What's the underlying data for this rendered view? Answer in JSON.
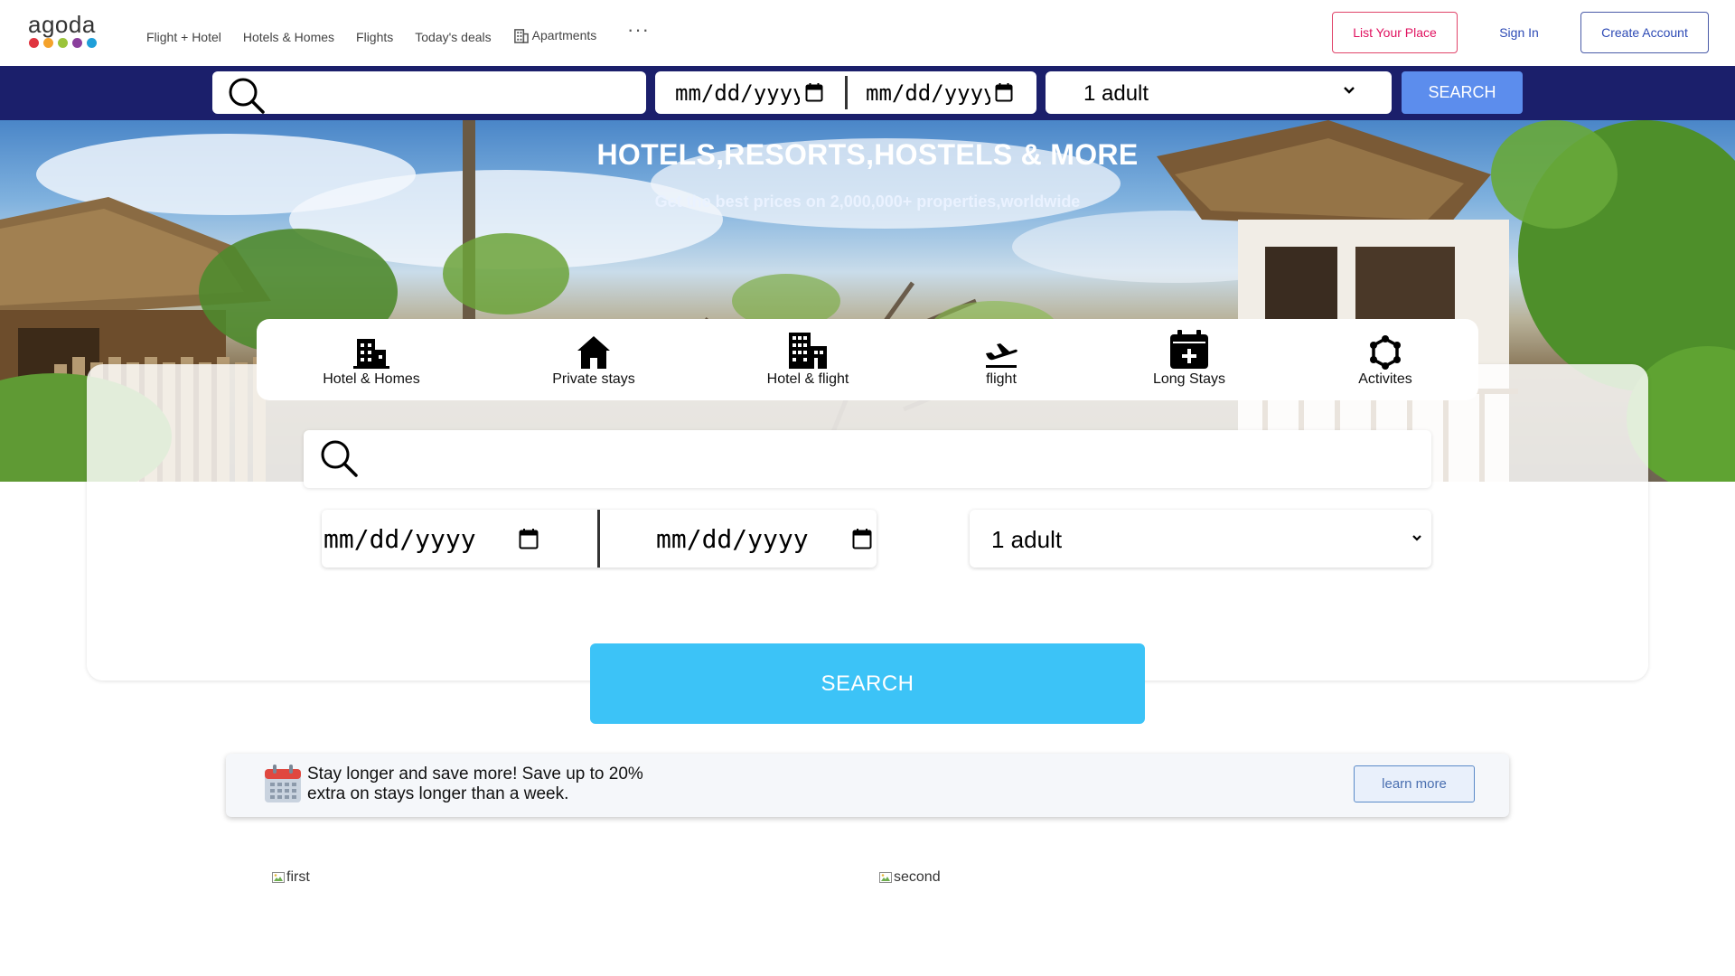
{
  "brand": {
    "logo_text": "agoda",
    "dot_colors": [
      "#e0343f",
      "#f4a22b",
      "#9bc43a",
      "#8a3f9c",
      "#1f9fd9"
    ]
  },
  "nav": {
    "links": [
      "Flight + Hotel",
      "Hotels & Homes",
      "Flights",
      "Today's deals"
    ],
    "apartments_label": "Apartments",
    "more_label": "···",
    "list_place": "List Your Place",
    "sign_in": "Sign In",
    "create_account": "Create Account"
  },
  "topbar": {
    "checkin_placeholder": "mm/dd/yyyy",
    "checkout_placeholder": "mm/dd/yyyy",
    "guests": "1 adult",
    "search_button": "SEARCH"
  },
  "hero": {
    "title": "HOTELS,RESORTS,HOSTELS & MORE",
    "subtitle": "Get the best prices on 2,000,000+ properties,worldwide"
  },
  "categories": [
    {
      "label": "Hotel & Homes",
      "icon": "building-icon"
    },
    {
      "label": "Private stays",
      "icon": "house-icon"
    },
    {
      "label": "Hotel & flight",
      "icon": "city-icon"
    },
    {
      "label": "flight",
      "icon": "plane-icon"
    },
    {
      "label": "Long Stays",
      "icon": "calendar-plus-icon"
    },
    {
      "label": "Activites",
      "icon": "activities-icon"
    }
  ],
  "panel": {
    "checkin_placeholder": "mm/dd/yyyy",
    "checkout_placeholder": "mm/dd/yyyy",
    "guests": "1 adult",
    "search_button": "SEARCH"
  },
  "promo": {
    "text": "Stay longer and save more! Save up to 20% extra on stays longer than a week.",
    "button": "learn more"
  },
  "images": [
    {
      "alt": "first"
    },
    {
      "alt": "second"
    }
  ]
}
